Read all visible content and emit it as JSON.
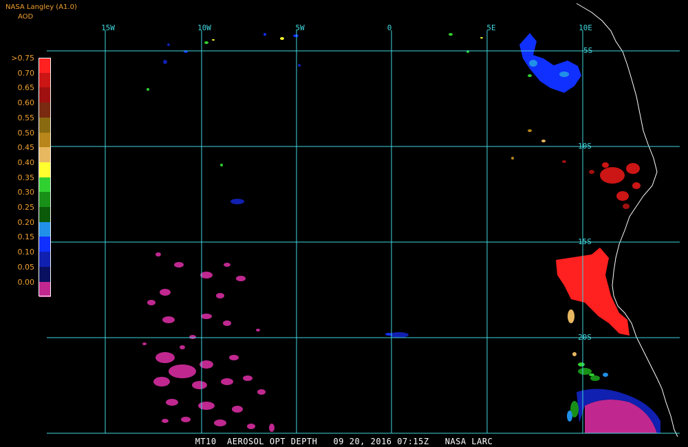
{
  "header": {
    "source": "NASA Langley (A1.0)",
    "product": "AOD"
  },
  "legend": {
    "items": [
      {
        "label": ">0.75",
        "color": "#ff2020"
      },
      {
        "label": "0.70",
        "color": "#cc1515"
      },
      {
        "label": "0.65",
        "color": "#a01010"
      },
      {
        "label": "0.60",
        "color": "#7a2a10"
      },
      {
        "label": "0.55",
        "color": "#8a6a10"
      },
      {
        "label": "0.50",
        "color": "#b8861a"
      },
      {
        "label": "0.45",
        "color": "#e8b860"
      },
      {
        "label": "0.40",
        "color": "#ffff30"
      },
      {
        "label": "0.35",
        "color": "#30d030"
      },
      {
        "label": "0.30",
        "color": "#189018"
      },
      {
        "label": "0.25",
        "color": "#0a5a0a"
      },
      {
        "label": "0.20",
        "color": "#2090e8"
      },
      {
        "label": "0.15",
        "color": "#1030ff"
      },
      {
        "label": "0.10",
        "color": "#1020b0"
      },
      {
        "label": "0.05",
        "color": "#0a1060"
      },
      {
        "label": "0.00",
        "color": "#c02890"
      }
    ]
  },
  "map": {
    "longitude_labels": [
      "15W",
      "10W",
      "5W",
      "0",
      "5E",
      "10E"
    ],
    "latitude_labels": [
      "5S",
      "10S",
      "15S",
      "20S"
    ],
    "grid_color": "#40d8e0",
    "coast_color": "#ffffff"
  },
  "footer": {
    "caption": "MT10  AEROSOL OPT DEPTH   09 20, 2016 07:15Z   NASA LARC"
  }
}
